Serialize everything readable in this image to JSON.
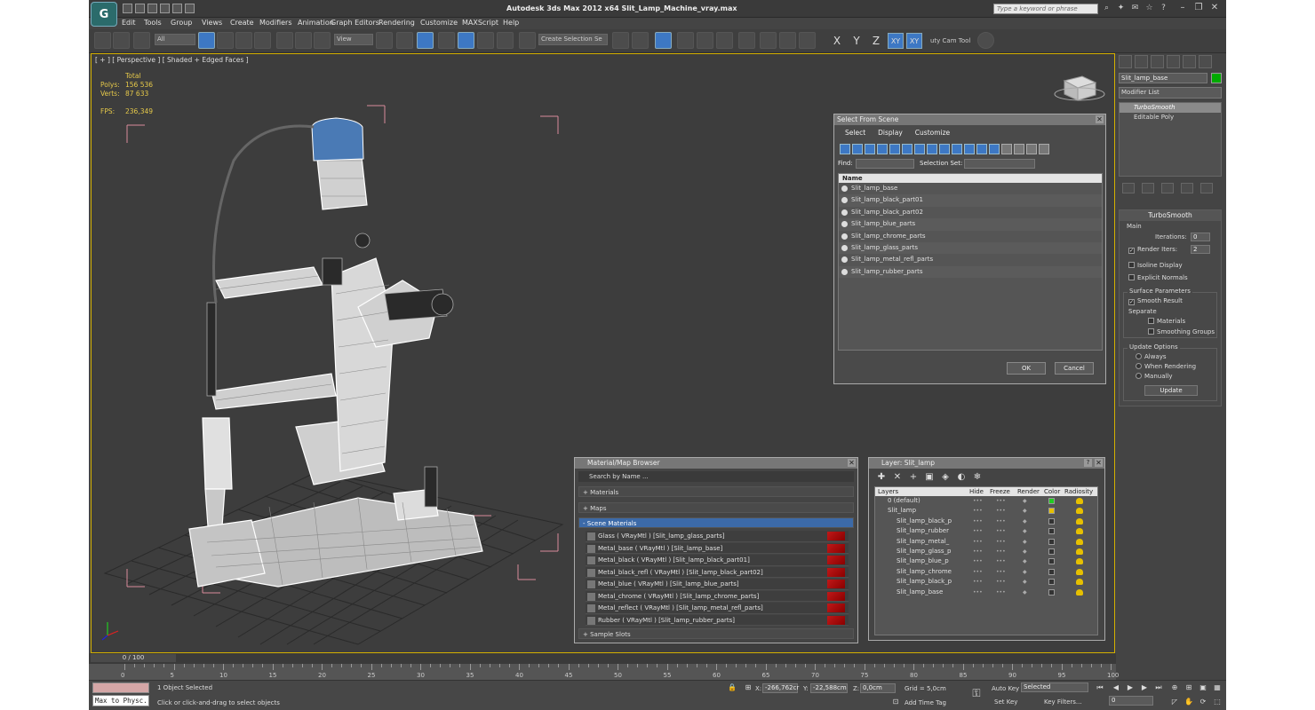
{
  "titlebar": {
    "title": "Autodesk 3ds Max  2012 x64     Slit_Lamp_Machine_vray.max",
    "search_placeholder": "Type a keyword or phrase"
  },
  "menu": [
    "Edit",
    "Tools",
    "Group",
    "Views",
    "Create",
    "Modifiers",
    "Animation",
    "Graph Editors",
    "Rendering",
    "Customize",
    "MAXScript",
    "Help"
  ],
  "toolbar": {
    "filter_value": "All",
    "refcoord_value": "View",
    "named_selection_placeholder": "Create Selection Se",
    "axis_x": "X",
    "axis_y": "Y",
    "axis_z": "Z",
    "axis_xy": "XY",
    "axis_xy2": "XY",
    "cam_tool_label": "uty Cam Tool"
  },
  "viewport": {
    "label": "[ + ] [ Perspective ] [ Shaded + Edged Faces ]",
    "stats": {
      "total_label": "Total",
      "polys_label": "Polys:",
      "polys_value": "156 536",
      "verts_label": "Verts:",
      "verts_value": "87 633",
      "fps_label": "FPS:",
      "fps_value": "236,349"
    }
  },
  "command_panel": {
    "object_name": "Slit_lamp_base",
    "modifier_list": "Modifier List",
    "stack": [
      "TurboSmooth",
      "Editable Poly"
    ],
    "rollout_title": "TurboSmooth",
    "main_label": "Main",
    "iterations_label": "Iterations:",
    "iterations_value": "0",
    "render_iters_label": "Render Iters:",
    "render_iters_value": "2",
    "isoline_label": "Isoline Display",
    "explicit_label": "Explicit Normals",
    "surface_label": "Surface Parameters",
    "smooth_result_label": "Smooth Result",
    "separate_label": "Separate",
    "materials_label": "Materials",
    "smoothing_groups_label": "Smoothing Groups",
    "update_options_label": "Update Options",
    "always_label": "Always",
    "when_rendering_label": "When Rendering",
    "manually_label": "Manually",
    "update_button": "Update"
  },
  "select_dialog": {
    "title": "Select From Scene",
    "menu": [
      "Select",
      "Display",
      "Customize"
    ],
    "find_label": "Find:",
    "selection_set_label": "Selection Set:",
    "column_name": "Name",
    "items": [
      "Slit_lamp_base",
      "Slit_lamp_black_part01",
      "Slit_lamp_black_part02",
      "Slit_lamp_blue_parts",
      "Slit_lamp_chrome_parts",
      "Slit_lamp_glass_parts",
      "Slit_lamp_metal_refl_parts",
      "Slit_lamp_rubber_parts"
    ],
    "ok_label": "OK",
    "cancel_label": "Cancel"
  },
  "material_browser": {
    "title": "Material/Map Browser",
    "search_placeholder": "Search by Name ...",
    "sections": [
      "+ Materials",
      "+ Maps",
      "- Scene Materials",
      "+ Sample Slots"
    ],
    "materials": [
      "Glass ( VRayMtl ) [Slit_lamp_glass_parts]",
      "Metal_base ( VRayMtl ) [Slit_lamp_base]",
      "Metal_black ( VRayMtl ) [Slit_lamp_black_part01]",
      "Metal_black_refl ( VRayMtl ) [Slit_lamp_black_part02]",
      "Metal_blue ( VRayMtl ) [Slit_lamp_blue_parts]",
      "Metal_chrome ( VRayMtl ) [Slit_lamp_chrome_parts]",
      "Metal_reflect ( VRayMtl ) [Slit_lamp_metal_refl_parts]",
      "Rubber ( VRayMtl ) [Slit_lamp_rubber_parts]"
    ]
  },
  "layer_dialog": {
    "title": "Layer: Slit_lamp",
    "columns": [
      "Layers",
      "Hide",
      "Freeze",
      "Render",
      "Color",
      "Radiosity"
    ],
    "rows": [
      {
        "name": "0 (default)",
        "indent": 1,
        "color": "#22cc22"
      },
      {
        "name": "Slit_lamp",
        "indent": 1,
        "color": "#e6c000"
      },
      {
        "name": "Slit_lamp_black_p",
        "indent": 2,
        "color": ""
      },
      {
        "name": "Slit_lamp_rubber",
        "indent": 2,
        "color": ""
      },
      {
        "name": "Slit_lamp_metal_",
        "indent": 2,
        "color": ""
      },
      {
        "name": "Slit_lamp_glass_p",
        "indent": 2,
        "color": ""
      },
      {
        "name": "Slit_lamp_blue_p",
        "indent": 2,
        "color": ""
      },
      {
        "name": "Slit_lamp_chrome",
        "indent": 2,
        "color": ""
      },
      {
        "name": "Slit_lamp_black_p",
        "indent": 2,
        "color": ""
      },
      {
        "name": "Slit_lamp_base",
        "indent": 2,
        "color": ""
      }
    ]
  },
  "timeline": {
    "slider_label": "0 / 100",
    "ticks": [
      "0",
      "5",
      "10",
      "15",
      "20",
      "25",
      "30",
      "35",
      "40",
      "45",
      "50",
      "55",
      "60",
      "65",
      "70",
      "75",
      "80",
      "85",
      "90",
      "95",
      "100"
    ]
  },
  "statusbar": {
    "maxscript_label": "Max to Physc.",
    "selected_text": "1 Object Selected",
    "prompt_text": "Click or click-and-drag to select objects",
    "x_label": "X:",
    "x_value": "-266,762cr",
    "y_label": "Y:",
    "y_value": "-22,588cm",
    "z_label": "Z:",
    "z_value": "0,0cm",
    "grid_label": "Grid = 5,0cm",
    "add_time_tag": "Add Time Tag",
    "auto_key": "Auto Key",
    "set_key": "Set Key",
    "selected_dd": "Selected",
    "key_filters": "Key Filters...",
    "frame_value": "0"
  }
}
